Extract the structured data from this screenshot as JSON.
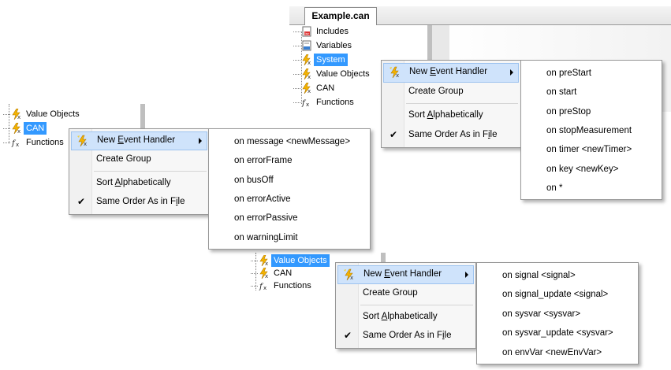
{
  "top_right": {
    "tab_title": "Example.can",
    "tree": [
      "Includes",
      "Variables",
      "System",
      "Value Objects",
      "CAN",
      "Functions"
    ],
    "icons": [
      "includes-icon",
      "variables-icon",
      "event-handler-icon",
      "event-handler-icon",
      "event-handler-icon",
      "function-icon"
    ],
    "selected_index": 2,
    "menu": {
      "items": [
        "New Event Handler",
        "Create Group",
        "Sort Alphabetically",
        "Same Order As in File"
      ],
      "mnemonics": [
        "E",
        "",
        "A",
        "i"
      ]
    },
    "submenu": [
      "on preStart",
      "on start",
      "on preStop",
      "on stopMeasurement",
      "on timer <newTimer>",
      "on key <newKey>",
      "on *"
    ]
  },
  "left": {
    "tree": [
      "Value Objects",
      "CAN",
      "Functions"
    ],
    "icons": [
      "event-handler-icon",
      "event-handler-icon",
      "function-icon"
    ],
    "selected_index": 1,
    "menu": {
      "items": [
        "New Event Handler",
        "Create Group",
        "Sort Alphabetically",
        "Same Order As in File"
      ]
    },
    "submenu": [
      "on message <newMessage>",
      "on errorFrame",
      "on busOff",
      "on errorActive",
      "on errorPassive",
      "on warningLimit"
    ]
  },
  "bottom": {
    "tree": [
      "Value Objects",
      "CAN",
      "Functions"
    ],
    "icons": [
      "event-handler-icon",
      "event-handler-icon",
      "function-icon"
    ],
    "selected_index": 0,
    "menu": {
      "items": [
        "New Event Handler",
        "Create Group",
        "Sort Alphabetically",
        "Same Order As in File"
      ]
    },
    "submenu": [
      "on signal <signal>",
      "on signal_update <signal>",
      "on sysvar <sysvar>",
      "on sysvar_update <sysvar>",
      "on envVar <newEnvVar>"
    ]
  },
  "colors": {
    "selection": "#3399ff",
    "menu_highlight": "#cfe3fb",
    "menu_highlight_border": "#9dc3ef"
  }
}
